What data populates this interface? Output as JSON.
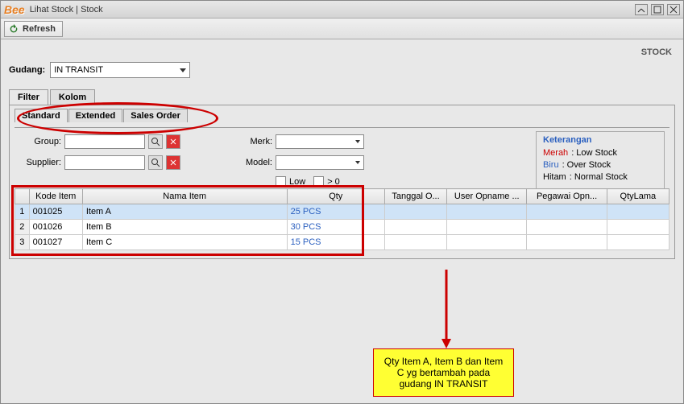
{
  "titlebar": {
    "logo": "Bee",
    "title": "Lihat Stock | Stock"
  },
  "toolbar": {
    "refresh": "Refresh"
  },
  "stock_label": "STOCK",
  "gudang": {
    "label": "Gudang:",
    "value": "IN TRANSIT"
  },
  "tabs": {
    "filter": "Filter",
    "kolom": "Kolom"
  },
  "subtabs": {
    "standard": "Standard",
    "extended": "Extended",
    "salesorder": "Sales Order"
  },
  "filters": {
    "group": "Group:",
    "supplier": "Supplier:",
    "merk": "Merk:",
    "model": "Model:",
    "low": "Low",
    "gt0": "> 0"
  },
  "keterangan": {
    "title": "Keterangan",
    "merah": "Merah",
    "merah_val": ": Low Stock",
    "biru": "Biru",
    "biru_val": ": Over Stock",
    "hitam": "Hitam",
    "hitam_val": ": Normal Stock"
  },
  "table": {
    "headers": {
      "kode": "Kode Item",
      "nama": "Nama Item",
      "qty": "Qty",
      "tgl": "Tanggal O...",
      "user": "User Opname ...",
      "pegawai": "Pegawai Opn...",
      "qtylama": "QtyLama"
    },
    "rows": [
      {
        "n": "1",
        "kode": "001025",
        "nama": "Item A",
        "qty": "25 PCS"
      },
      {
        "n": "2",
        "kode": "001026",
        "nama": "Item B",
        "qty": "30 PCS"
      },
      {
        "n": "3",
        "kode": "001027",
        "nama": "Item C",
        "qty": "15 PCS"
      }
    ]
  },
  "callout": "Qty Item A, Item B dan Item C yg bertambah pada gudang IN TRANSIT"
}
